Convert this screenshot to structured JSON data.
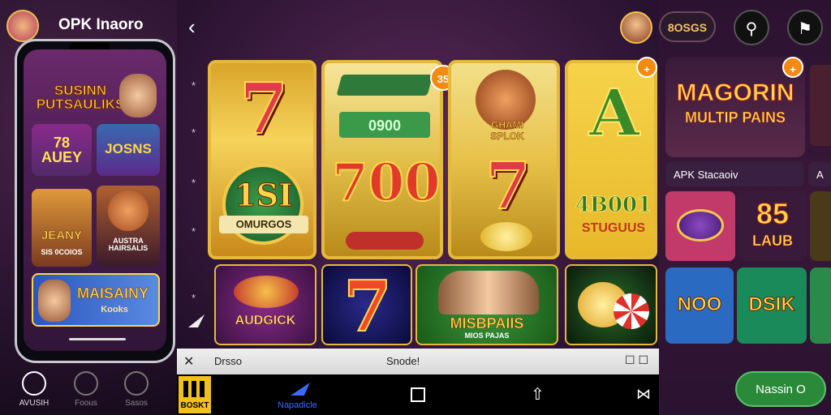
{
  "app": {
    "title": "OPK Inaoro"
  },
  "phone": {
    "banner_title": "SUSINN PUTSAULIKS",
    "tile_1_text": "78 AUEY",
    "tile_2_text": "JOSNS",
    "tile_3_text": "JEANY",
    "tile_3_caption": "SIS 0COIOS",
    "tile_4_text": "AUSTRA HAIRSALIS",
    "tile_5_title": "MAISAINY",
    "tile_5_sub": "Kooks"
  },
  "left_nav": [
    "AVUSIH",
    "Foous",
    "Sasos"
  ],
  "reels": {
    "reel1_top": "7",
    "reel1_mid": "1SI",
    "reel1_banner": "OMURGOS",
    "reel2_top": "0900",
    "reel2_mid": "700",
    "reel2_badge": "35",
    "reel3_mid_title": "GHAMI",
    "reel3_mid_sub": "SPLOK",
    "reel3_bottom": "7",
    "reel4_top": "A",
    "reel4_big": "4B001",
    "reel4_sub": "STUGUUS"
  },
  "side_numbers": [
    "*",
    "*",
    "*",
    "*",
    "*"
  ],
  "games": {
    "game1_label": "AUDGICK",
    "game2_label": "7",
    "game3_label": "MISBPAIIS",
    "game3_sub": "MIOS PAJAS"
  },
  "bar": {
    "left_text": "Drsso",
    "mid_text": "Snode!",
    "right_text": "☐ ☐"
  },
  "bottom_nav": {
    "badge_text": "BOSKT",
    "active_label": "Napadicle"
  },
  "right": {
    "pill_text": "8OSGS",
    "badge_a": "+",
    "promo_title_1": "MAGORIN",
    "promo_title_2": "MULTIP PAINS",
    "apk_label": "APK Stacaoiv",
    "apk_label_2": "A",
    "tile_big_num": "85",
    "tile_big_sub": "LAUB",
    "tile_noo": "NOO",
    "tile_dsik": "DSIK",
    "cta": "Nassin O"
  },
  "colors": {
    "accent_gold": "#e6b83b",
    "cta_green": "#2a8a3a",
    "badge_orange": "#f28a14"
  }
}
